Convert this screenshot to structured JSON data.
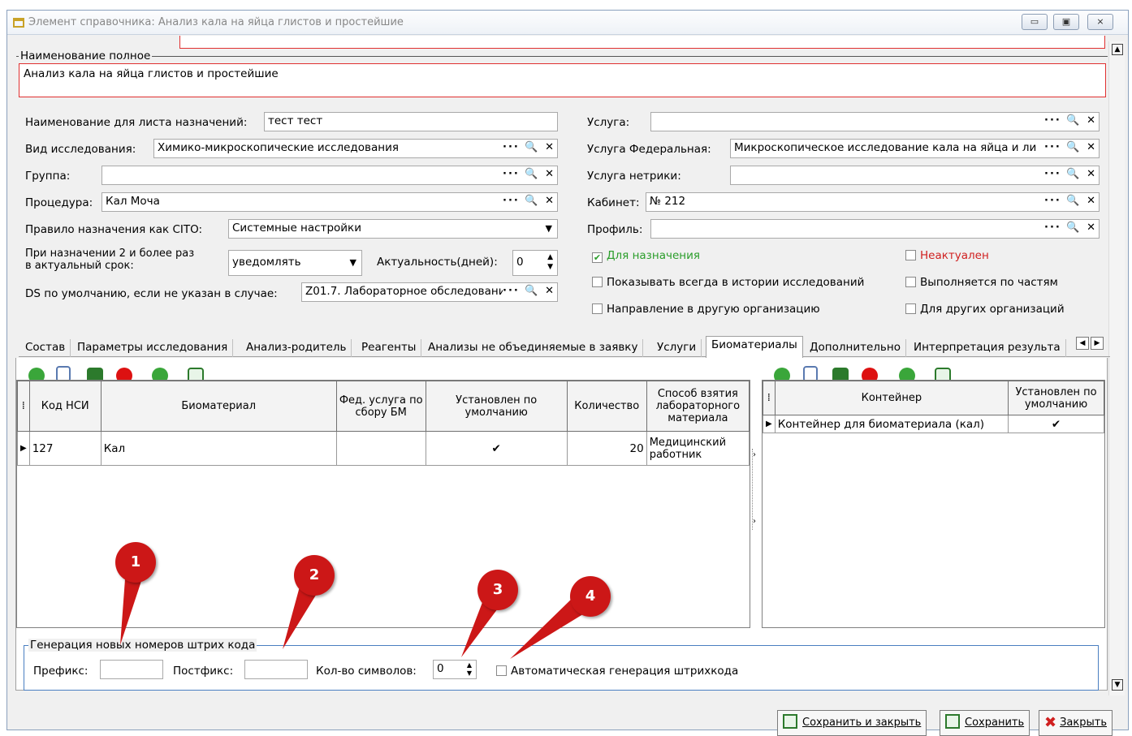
{
  "window": {
    "title": "Элемент справочника: Анализ кала на яйца глистов и простейшие",
    "min": "▭",
    "max": "▣",
    "close": "⨯"
  },
  "top": {
    "full_name_label": "Наименование полное",
    "full_name_value": "Анализ кала на яйца глистов и простейшие"
  },
  "left_form": {
    "assign_list_label": "Наименование для листа назначений:",
    "assign_list_value": "тест тест",
    "research_type_label": "Вид исследования:",
    "research_type_value": "Химико-микроскопические исследования",
    "group_label": "Группа:",
    "group_value": "",
    "procedure_label": "Процедура:",
    "procedure_value": "Кал Моча",
    "cito_label": "Правило назначения как CITO:",
    "cito_value": "Системные настройки",
    "repeat_label_1": "При назначении 2 и более раз",
    "repeat_label_2": "в актуальный срок:",
    "repeat_value": "уведомлять",
    "actuality_label": "Актуальность(дней):",
    "actuality_value": "0",
    "ds_label": "DS по умолчанию, если не указан в случае:",
    "ds_value": "Z01.7. Лабораторное обследовани"
  },
  "right_form": {
    "service_label": "Услуга:",
    "service_value": "",
    "fed_service_label": "Услуга Федеральная:",
    "fed_service_value": "Микроскопическое исследование кала на яйца и ли",
    "netrika_label": "Услуга нетрики:",
    "netrika_value": "",
    "cabinet_label": "Кабинет:",
    "cabinet_value": "№ 212",
    "profile_label": "Профиль:",
    "profile_value": ""
  },
  "checks": {
    "for_assign": "Для назначения",
    "not_actual": "Неактуален",
    "show_history": "Показывать всегда в истории исследований",
    "by_parts": "Выполняется по частям",
    "referral": "Направление в другую организацию",
    "other_orgs": "Для других организаций"
  },
  "field_buttons": "··· 🔍 ✕",
  "tabs": [
    "Состав",
    "Параметры исследования",
    "Анализ-родитель",
    "Реагенты",
    "Анализы не объединяемые в заявку",
    "Услуги",
    "Биоматериалы",
    "Дополнительно",
    "Интерпретация результа"
  ],
  "left_grid": {
    "headers": [
      "Код НСИ",
      "Биоматериал",
      "Фед. услуга по сбору БМ",
      "Установлен по умолчанию",
      "Количество",
      "Способ взятия лабораторного материала"
    ],
    "rows": [
      {
        "code": "127",
        "bio": "Кал",
        "fed": "",
        "default": "✔",
        "qty": "20",
        "method": "Медицинский работник"
      }
    ]
  },
  "right_grid": {
    "headers": [
      "Контейнер",
      "Установлен по умолчанию"
    ],
    "rows": [
      {
        "container": "Контейнер для биоматериала (кал)",
        "default": "✔"
      }
    ]
  },
  "barcode": {
    "group_label": "Генерация новых номеров штрих кода",
    "prefix_label": "Префикс:",
    "prefix_value": "",
    "postfix_label": "Постфикс:",
    "postfix_value": "",
    "chars_label": "Кол-во символов:",
    "chars_value": "0",
    "auto_label": "Автоматическая генерация штрихкода"
  },
  "markers": [
    "1",
    "2",
    "3",
    "4"
  ],
  "buttons": {
    "save_close": "Сохранить и закрыть",
    "save": "Сохранить",
    "close": "Закрыть"
  },
  "colors": {
    "accent_green": "#2a9d2a",
    "accent_red": "#d02020",
    "marker_red": "#cc1717"
  }
}
